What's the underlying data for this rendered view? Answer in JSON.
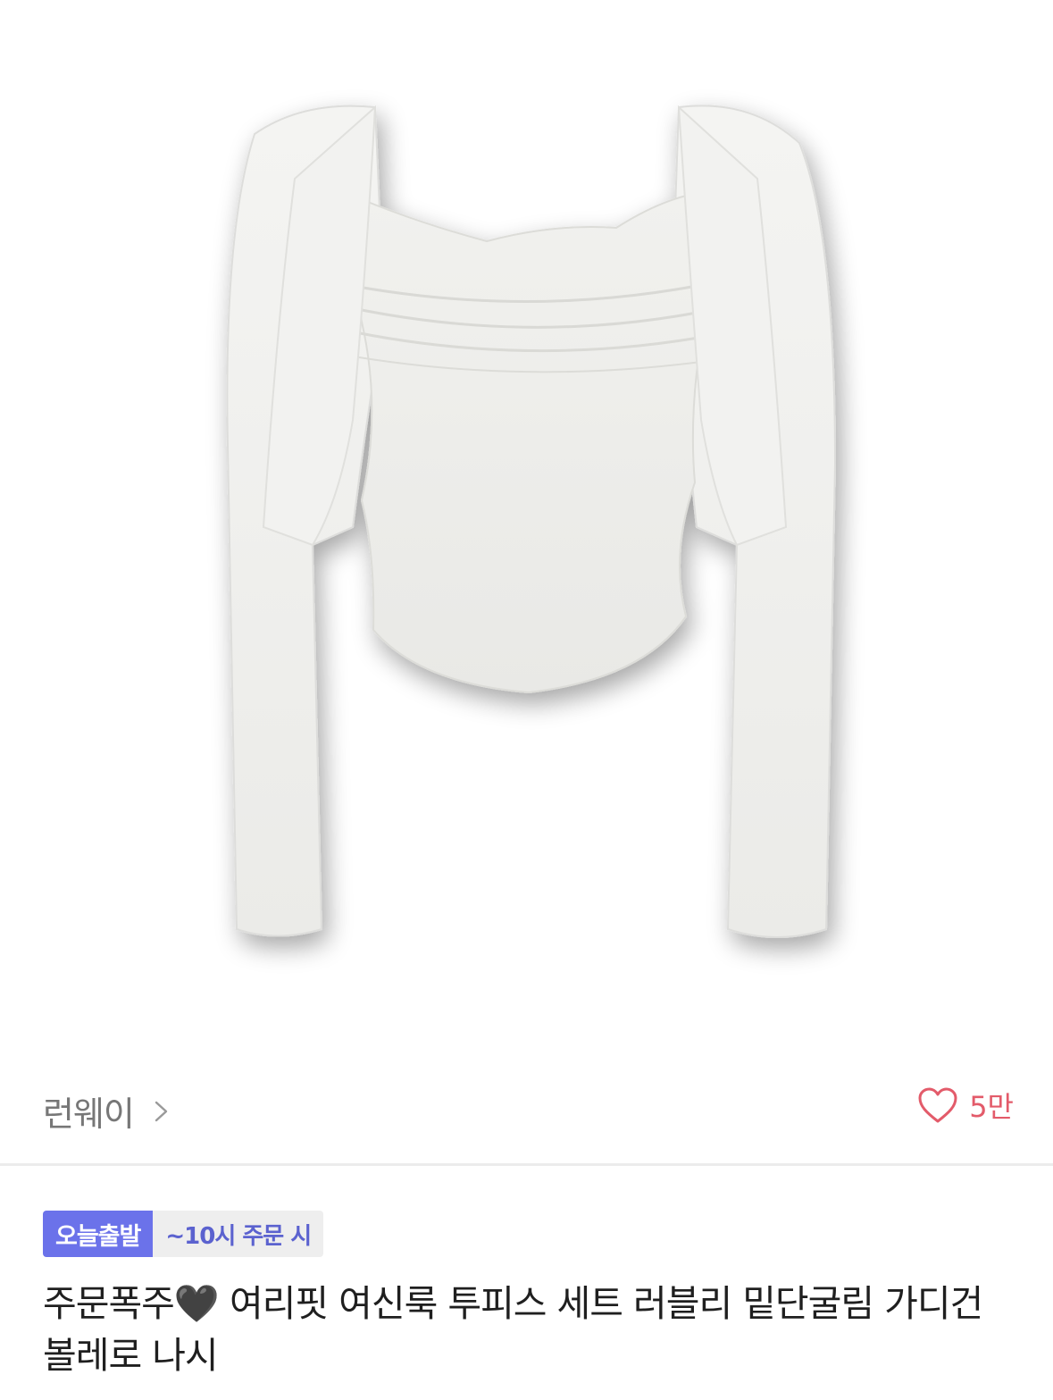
{
  "product_image": {
    "alt": "product-photo"
  },
  "store": {
    "name": "런웨이",
    "chevron_icon": "chevron-right-icon"
  },
  "like": {
    "icon": "heart-outline-icon",
    "count": "5만",
    "color": "#e35b6a"
  },
  "delivery": {
    "badge": "오늘출발",
    "cutoff": "~10시 주문 시",
    "badge_color": "#6b72ea",
    "cutoff_color": "#5b62cf"
  },
  "product": {
    "title": "주문폭주🖤 여리핏 여신룩 투피스 세트 러블리 밑단굴림 가디건 볼레로 나시"
  }
}
